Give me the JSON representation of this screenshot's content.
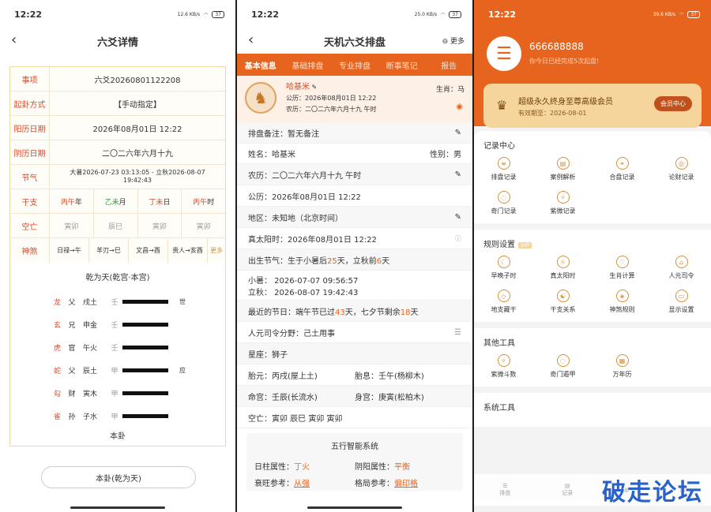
{
  "p1": {
    "time": "12:22",
    "net": "12.6 KB/s",
    "bat": "37",
    "title": "六爻详情",
    "rows": {
      "item_k": "事项",
      "item_v": "六爻20260801122208",
      "way_k": "起卦方式",
      "way_v": "【手动指定】",
      "solar_k": "阳历日期",
      "solar_v": "2026年08月01日 12:22",
      "lunar_k": "阴历日期",
      "lunar_v": "二〇二六年六月十九",
      "jq_k": "节气",
      "jq_v1": "大暑2026-07-23 03:13:05 - 立秋2026-08-07",
      "jq_v2": "19:42:43",
      "gz_k": "干支",
      "kw_k": "空亡",
      "ss_k": "神煞"
    },
    "ganzhi": [
      {
        "a": "丙午",
        "b": "年"
      },
      {
        "a": "乙未",
        "b": "月"
      },
      {
        "a": "丁未",
        "b": "日"
      },
      {
        "a": "丙午",
        "b": "时"
      }
    ],
    "kongwang": [
      "寅卯",
      "辰巳",
      "寅卯",
      "寅卯"
    ],
    "shensha": [
      "日禄→午",
      "羊刃→巳",
      "文昌→酉",
      "贵人→亥酉"
    ],
    "more": "更多",
    "hex_title": "乾为天(乾宫·本宫)",
    "yao": [
      {
        "god": "龙",
        "rel": "父",
        "branch": "戌土",
        "stem": "壬",
        "mark": "世"
      },
      {
        "god": "玄",
        "rel": "兄",
        "branch": "申金",
        "stem": "壬",
        "mark": ""
      },
      {
        "god": "虎",
        "rel": "官",
        "branch": "午火",
        "stem": "壬",
        "mark": ""
      },
      {
        "god": "蛇",
        "rel": "父",
        "branch": "辰土",
        "stem": "甲",
        "mark": "应"
      },
      {
        "god": "勾",
        "rel": "财",
        "branch": "寅木",
        "stem": "甲",
        "mark": ""
      },
      {
        "god": "雀",
        "rel": "孙",
        "branch": "子水",
        "stem": "甲",
        "mark": ""
      }
    ],
    "bengua": "本卦",
    "button": "本卦(乾为天)"
  },
  "p2": {
    "time": "12:22",
    "net": "25.0 KB/s",
    "bat": "37",
    "title": "天机六爻排盘",
    "more": "更多",
    "tabs": [
      "基本信息",
      "基础排盘",
      "专业排盘",
      "断事笔记",
      "报告"
    ],
    "name": "哈基米",
    "zodiac": "生肖：马",
    "psolar": "公历：2026年08月01日 12:22",
    "plunar": "农历：二〇二六年六月十九  午时",
    "note": "排盘备注：暂无备注",
    "namerow": "姓名：哈基米",
    "gender": "性别：男",
    "lunar": "农历：二〇二六年六月十九  午时",
    "solar": "公历：2026年08月01日 12:22",
    "region": "地区：未知地（北京时间）",
    "truesun": "真太阳时：2026年08月01日 12:22",
    "jq_a": "出生节气：生于小暑后",
    "jq_n1": "25",
    "jq_b": "天，立秋前",
    "jq_n2": "6",
    "jq_c": "天",
    "xs": "小暑：   2026-07-07 09:56:57",
    "lq": "立秋：   2026-08-07 19:42:43",
    "fest_a": "最近的节日：端午节已过",
    "fest_n1": "43",
    "fest_b": "天，七夕节剩余",
    "fest_n2": "18",
    "fest_c": "天",
    "renyuan": "人元司令分野：己土用事",
    "star": "星座：狮子",
    "taiyuan": "胎元：丙戌(屋上土)",
    "taixi": "胎息：壬午(杨柳木)",
    "minggong": "命宫：壬辰(长流水)",
    "shengong": "身宫：庚寅(松柏木)",
    "kw": "空亡：寅卯 辰巳 寅卯 寅卯",
    "wx_title": "五行智能系统",
    "rz_k": "日柱属性：",
    "rz_v": "丁火",
    "yy_k": "阴阳属性：",
    "yy_v": "平衡",
    "sw_k": "衰旺参考：",
    "sw_v": "从强",
    "gj_k": "格局参考：",
    "gj_v": "偏印格"
  },
  "p3": {
    "time": "12:22",
    "net": "39.6 KB/s",
    "bat": "37",
    "uid": "666688888",
    "usub": "你今日已经完成5次起盘!",
    "vip_title": "超级永久终身至尊高级会员",
    "vip_exp": "有效期至：2026-08-01",
    "vip_btn": "会员中心",
    "s1": "记录中心",
    "s1_items": [
      "排盘记录",
      "案例解析",
      "合盘记录",
      "论财记录",
      "奇门记录",
      "紫微记录"
    ],
    "s2": "规则设置",
    "s2_tag": "VIP",
    "s2_items": [
      "早晚子时",
      "真太阳时",
      "生肖计算",
      "人元司令",
      "地支藏干",
      "干支关系",
      "神煞规则",
      "显示设置"
    ],
    "s3": "其他工具",
    "s3_items": [
      "紫微斗数",
      "奇门遁甲",
      "万年历"
    ],
    "s4": "系统工具",
    "nav": [
      "排盘",
      "记录",
      "",
      ""
    ]
  },
  "watermark": "破走论坛"
}
